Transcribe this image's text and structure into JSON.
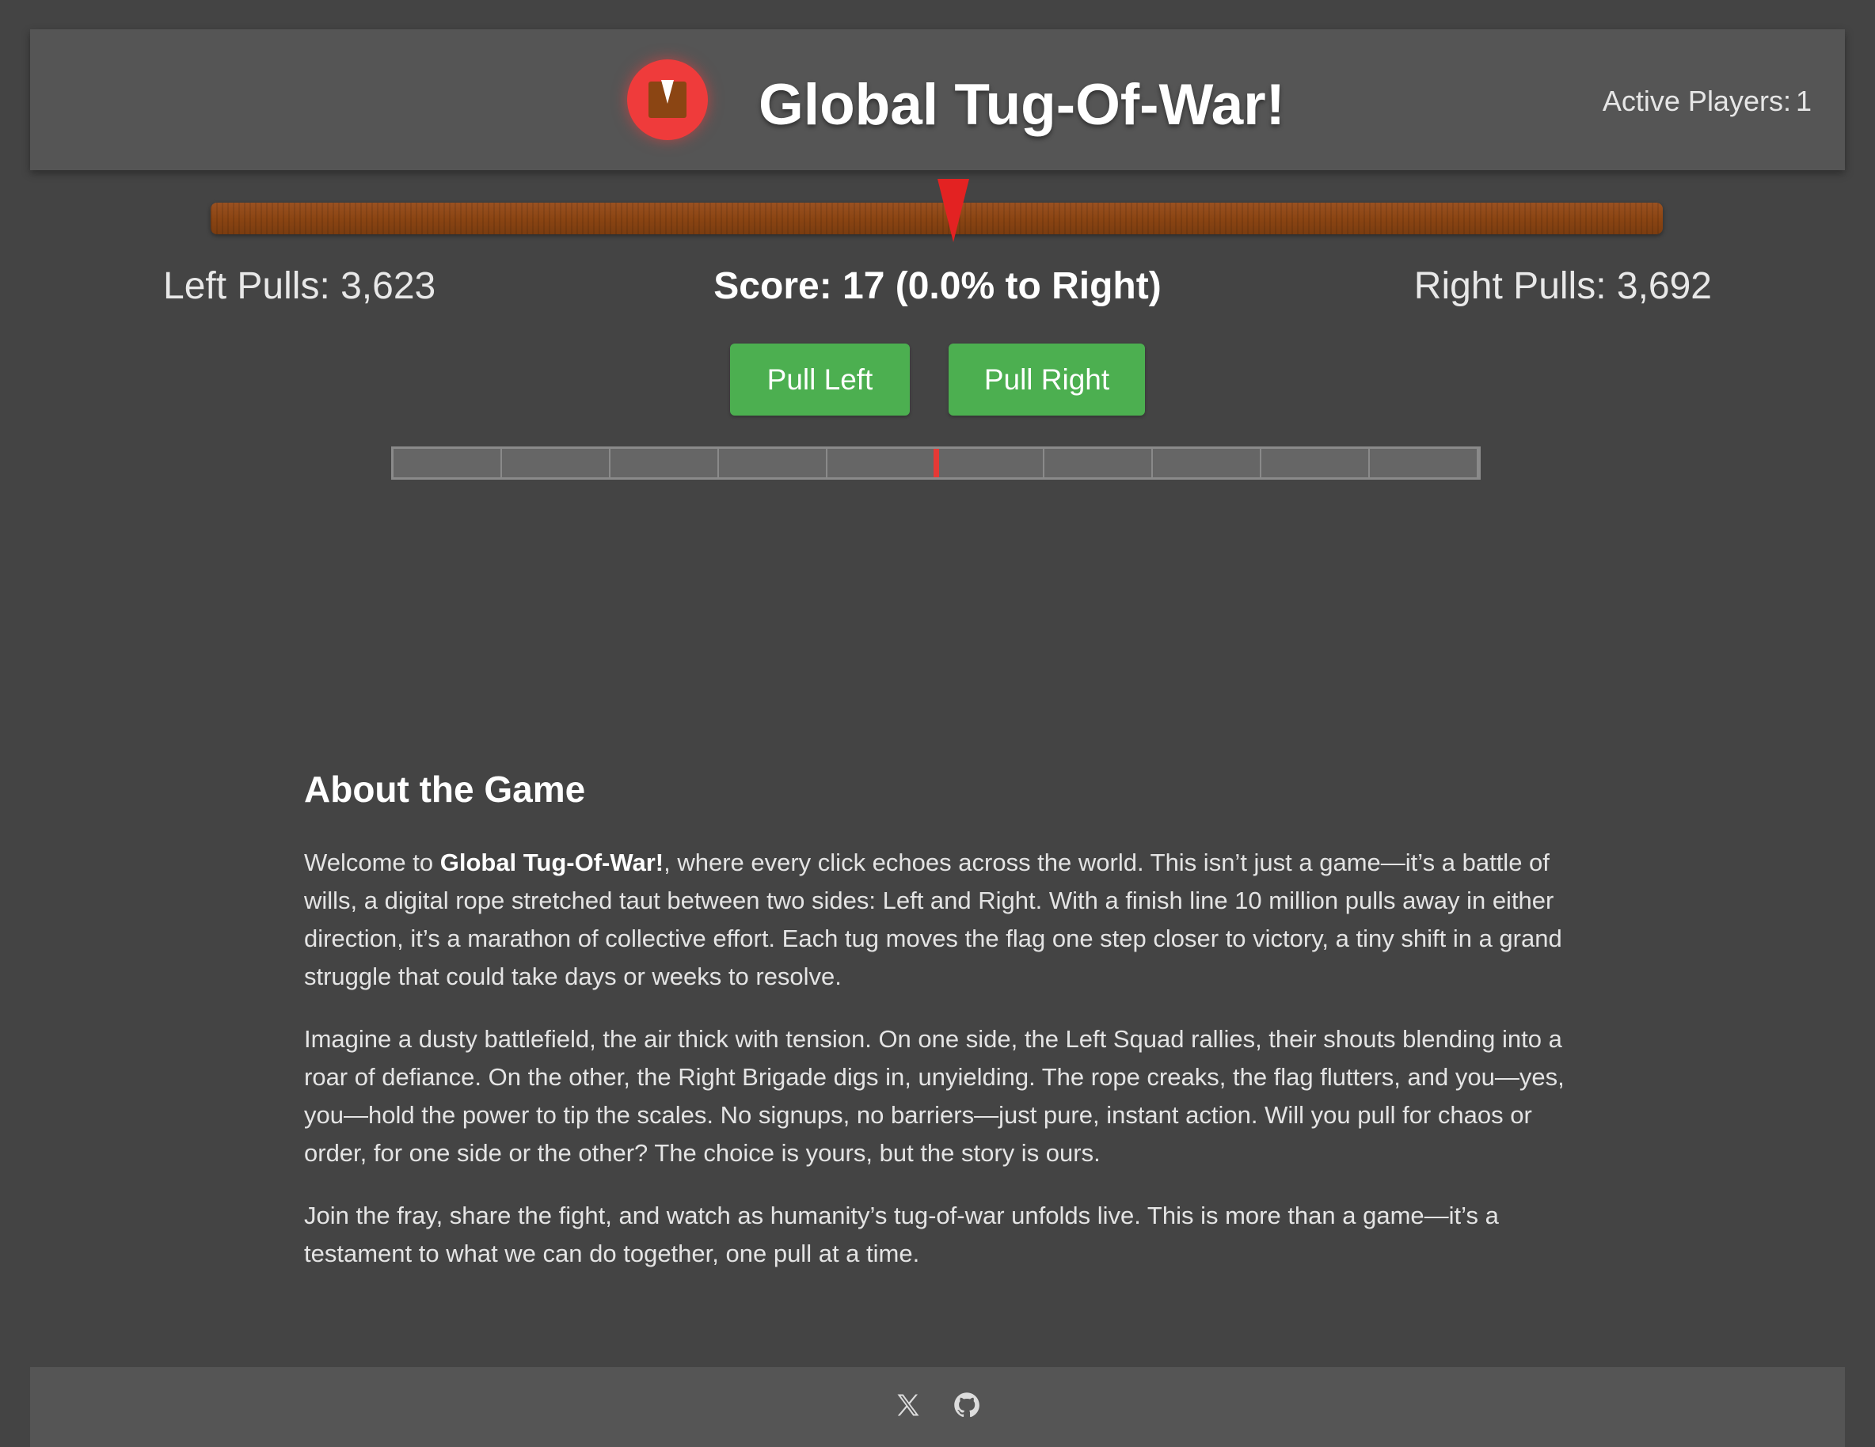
{
  "header": {
    "title": "Global Tug-Of-War!",
    "logo_icon": "rope-flag-logo-icon",
    "active_players_label": "Active Players:",
    "active_players_value": "1"
  },
  "game": {
    "marker_position_fraction": 0.5,
    "left_pulls": "Left Pulls: 3,623",
    "right_pulls": "Right Pulls: 3,692",
    "score": "Score: 17 (0.0% to Right)",
    "buttons": {
      "pull_left": "Pull Left",
      "pull_right": "Pull Right"
    },
    "progress": {
      "segments": 10,
      "marker_fraction": 0.5
    }
  },
  "about": {
    "heading": "About the Game",
    "p1_pre": "Welcome to ",
    "p1_bold": "Global Tug-Of-War!",
    "p1_post": ", where every click echoes across the world. This isn’t just a game—it’s a battle of wills, a digital rope stretched taut between two sides: Left and Right. With a finish line 10 million pulls away in either direction, it’s a marathon of collective effort. Each tug moves the flag one step closer to victory, a tiny shift in a grand struggle that could take days or weeks to resolve.",
    "p2": "Imagine a dusty battlefield, the air thick with tension. On one side, the Left Squad rallies, their shouts blending into a roar of defiance. On the other, the Right Brigade digs in, unyielding. The rope creaks, the flag flutters, and you—yes, you—hold the power to tip the scales. No signups, no barriers—just pure, instant action. Will you pull for chaos or order, for one side or the other? The choice is yours, but the story is ours.",
    "p3": "Join the fray, share the fight, and watch as humanity’s tug-of-war unfolds live. This is more than a game—it’s a testament to what we can do together, one pull at a time."
  },
  "footer": {
    "icons": [
      "x-twitter-icon",
      "github-icon"
    ]
  },
  "colors": {
    "background": "#444444",
    "panel": "#555555",
    "rope": "#8b4513",
    "marker": "#e32222",
    "button": "#4caf50"
  }
}
